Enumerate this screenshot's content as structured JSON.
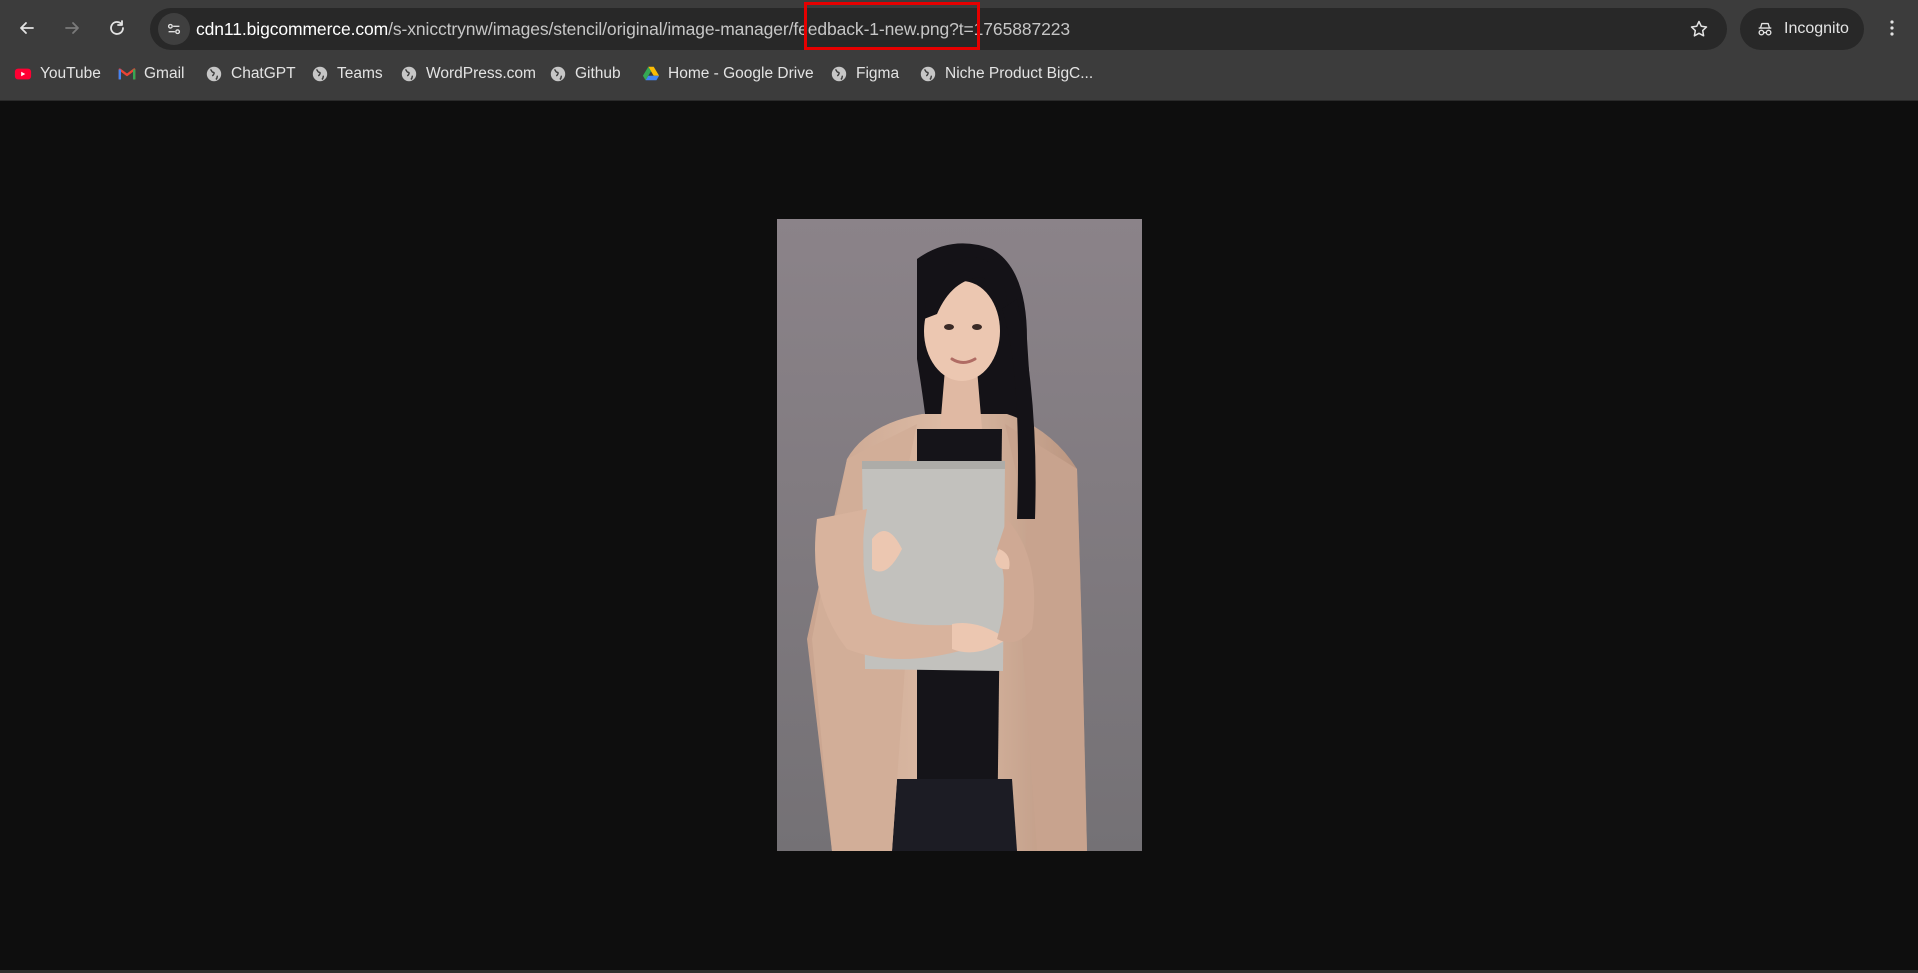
{
  "browser": {
    "url_host": "cdn11.bigcommerce.com",
    "url_path": "/s-xnicctrynw/images/stencil/original/image-manager/feedback-1-new.png?t=1765887223",
    "incognito_label": "Incognito"
  },
  "bookmarks": [
    {
      "label": "YouTube",
      "icon": "youtube-icon"
    },
    {
      "label": "Gmail",
      "icon": "gmail-icon"
    },
    {
      "label": "ChatGPT",
      "icon": "globe-icon"
    },
    {
      "label": "Teams",
      "icon": "globe-icon"
    },
    {
      "label": "WordPress.com",
      "icon": "globe-icon"
    },
    {
      "label": "Github",
      "icon": "globe-icon"
    },
    {
      "label": "Home - Google Drive",
      "icon": "google-drive-icon"
    },
    {
      "label": "Figma",
      "icon": "globe-icon"
    },
    {
      "label": "Niche Product BigC...",
      "icon": "globe-icon"
    }
  ],
  "colors": {
    "toolbar_bg": "#3c3c3c",
    "page_bg": "#0e0e0e",
    "highlight": "#e60000"
  }
}
